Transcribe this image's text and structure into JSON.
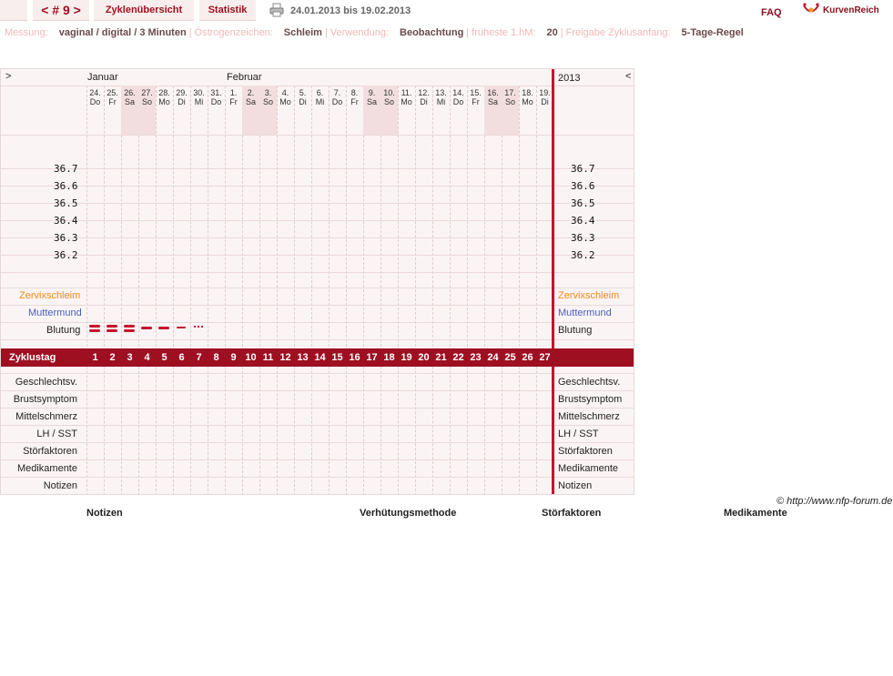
{
  "nav": {
    "cycle": "< # 9 >",
    "overview": "Zyklenübersicht",
    "stats": "Statistik",
    "range": "24.01.2013 bis 19.02.2013",
    "faq": "FAQ",
    "brand": "KurvenReich"
  },
  "settings": [
    {
      "label": "Messung:",
      "value": "vaginal / digital / 3 Minuten"
    },
    {
      "label": "Östrogenzeichen:",
      "value": "Schleim"
    },
    {
      "label": "Verwendung:",
      "value": "Beobachtung"
    },
    {
      "label": "früheste 1.hM:",
      "value": "20"
    },
    {
      "label": "Freigabe Zyklusanfang:",
      "value": "5-Tage-Regel"
    }
  ],
  "chart": {
    "nav_left": ">",
    "nav_right": "<",
    "month_jan": "Januar",
    "month_feb": "Februar",
    "year": "2013",
    "days": [
      {
        "d": "24.",
        "w": "Do",
        "we": false
      },
      {
        "d": "25.",
        "w": "Fr",
        "we": false
      },
      {
        "d": "26.",
        "w": "Sa",
        "we": true
      },
      {
        "d": "27.",
        "w": "So",
        "we": true
      },
      {
        "d": "28.",
        "w": "Mo",
        "we": false
      },
      {
        "d": "29.",
        "w": "Di",
        "we": false
      },
      {
        "d": "30.",
        "w": "Mi",
        "we": false
      },
      {
        "d": "31.",
        "w": "Do",
        "we": false
      },
      {
        "d": "1.",
        "w": "Fr",
        "we": false
      },
      {
        "d": "2.",
        "w": "Sa",
        "we": true
      },
      {
        "d": "3.",
        "w": "So",
        "we": true
      },
      {
        "d": "4.",
        "w": "Mo",
        "we": false
      },
      {
        "d": "5.",
        "w": "Di",
        "we": false
      },
      {
        "d": "6.",
        "w": "Mi",
        "we": false
      },
      {
        "d": "7.",
        "w": "Do",
        "we": false
      },
      {
        "d": "8.",
        "w": "Fr",
        "we": false
      },
      {
        "d": "9.",
        "w": "Sa",
        "we": true
      },
      {
        "d": "10.",
        "w": "So",
        "we": true
      },
      {
        "d": "11.",
        "w": "Mo",
        "we": false
      },
      {
        "d": "12.",
        "w": "Di",
        "we": false
      },
      {
        "d": "13.",
        "w": "Mi",
        "we": false
      },
      {
        "d": "14.",
        "w": "Do",
        "we": false
      },
      {
        "d": "15.",
        "w": "Fr",
        "we": false
      },
      {
        "d": "16.",
        "w": "Sa",
        "we": true
      },
      {
        "d": "17.",
        "w": "So",
        "we": true
      },
      {
        "d": "18.",
        "w": "Mo",
        "we": false
      },
      {
        "d": "19.",
        "w": "Di",
        "we": false
      }
    ],
    "temps": [
      "36.7",
      "36.6",
      "36.5",
      "36.4",
      "36.3",
      "36.2"
    ],
    "row_zervix": "Zervixschleim",
    "row_muttermund": "Muttermund",
    "row_blutung": "Blutung",
    "zyklustag": "Zyklustag",
    "bleeding": [
      "heavy",
      "heavy",
      "heavy",
      "medium",
      "medium",
      "light",
      "spotting"
    ],
    "bottom_rows": [
      "Geschlechtsv.",
      "Brustsymptom",
      "Mittelschmerz",
      "LH / SST",
      "Störfaktoren",
      "Medikamente",
      "Notizen"
    ],
    "colors": {
      "zervix": "#f08a1a",
      "muttermund": "#4a60c0",
      "accent": "#9e0f22"
    }
  },
  "footer": {
    "copyright": "© http://www.nfp-forum.de",
    "headers": [
      "Notizen",
      "Verhütungsmethode",
      "Störfaktoren",
      "Medikamente"
    ]
  }
}
